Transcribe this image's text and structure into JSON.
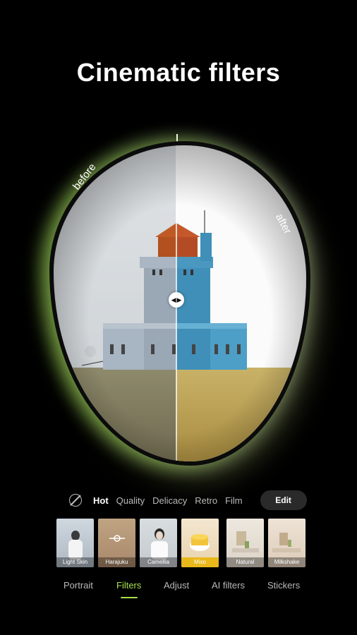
{
  "title": "Cinematic filters",
  "compare": {
    "before_label": "before",
    "after_label": "after",
    "handle_icon": "compare-arrows-icon"
  },
  "categories": {
    "none_icon": "no-filter-icon",
    "items": [
      {
        "label": "Hot",
        "active": true
      },
      {
        "label": "Quality",
        "active": false
      },
      {
        "label": "Delicacy",
        "active": false
      },
      {
        "label": "Retro",
        "active": false
      },
      {
        "label": "Film",
        "active": false
      }
    ],
    "edit_label": "Edit"
  },
  "filters": [
    {
      "label": "Light Skin",
      "selected": false
    },
    {
      "label": "Harajuku",
      "selected": false
    },
    {
      "label": "Camellia",
      "selected": false
    },
    {
      "label": "Miso",
      "selected": true
    },
    {
      "label": "Natural",
      "selected": false
    },
    {
      "label": "Milkshake",
      "selected": false
    }
  ],
  "tabs": [
    {
      "label": "Portrait",
      "active": false
    },
    {
      "label": "Filters",
      "active": true
    },
    {
      "label": "Adjust",
      "active": false
    },
    {
      "label": "AI filters",
      "active": false
    },
    {
      "label": "Stickers",
      "active": false
    }
  ],
  "colors": {
    "accent": "#a7e04a",
    "selected_filter": "#e9b81a",
    "edit_button": "#2a2a2a"
  }
}
